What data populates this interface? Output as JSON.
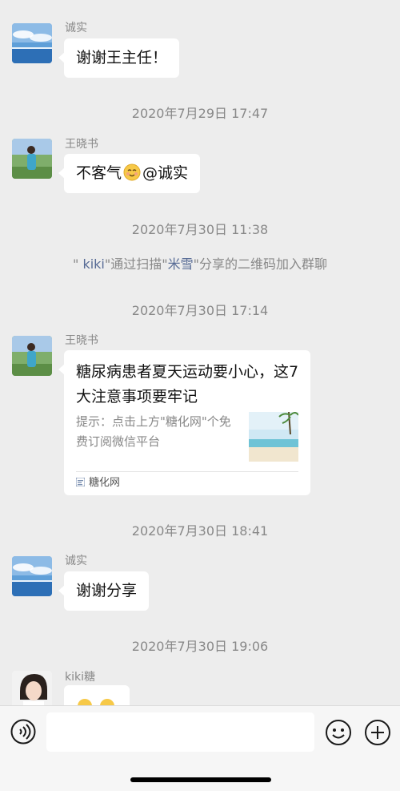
{
  "messages": {
    "m1": {
      "sender": "诚实",
      "text": "谢谢王主任！"
    },
    "t1": "2020年7月29日 17:47",
    "m2": {
      "sender": "王晓书",
      "text_before": "不客气",
      "emoji": "smiling-face-emoji",
      "text_after": "@诚实"
    },
    "t2": "2020年7月30日 11:38",
    "system": {
      "quote_open": "\" ",
      "name1": "kiki",
      "mid": "\"通过扫描\"",
      "name2": "米雪",
      "tail": "\"分享的二维码加入群聊"
    },
    "t3": "2020年7月30日 17:14",
    "m3": {
      "sender": "王晓书",
      "card_title": "糖尿病患者夏天运动要小心，这7大注意事项要牢记",
      "card_desc": "提示：点击上方\"糖化网\"个免费订阅微信平台",
      "card_source": "糖化网"
    },
    "t4": "2020年7月30日 18:41",
    "m4": {
      "sender": "诚实",
      "text": "谢谢分享"
    },
    "t5": "2020年7月30日 19:06",
    "m5": {
      "sender": "kiki糖"
    }
  },
  "input_bar": {
    "placeholder": "",
    "icons": [
      "voice-icon",
      "emoji-icon",
      "plus-icon"
    ]
  },
  "colors": {
    "background": "#ededed",
    "bubble": "#ffffff",
    "link": "#576b95",
    "meta_text": "#888888"
  }
}
